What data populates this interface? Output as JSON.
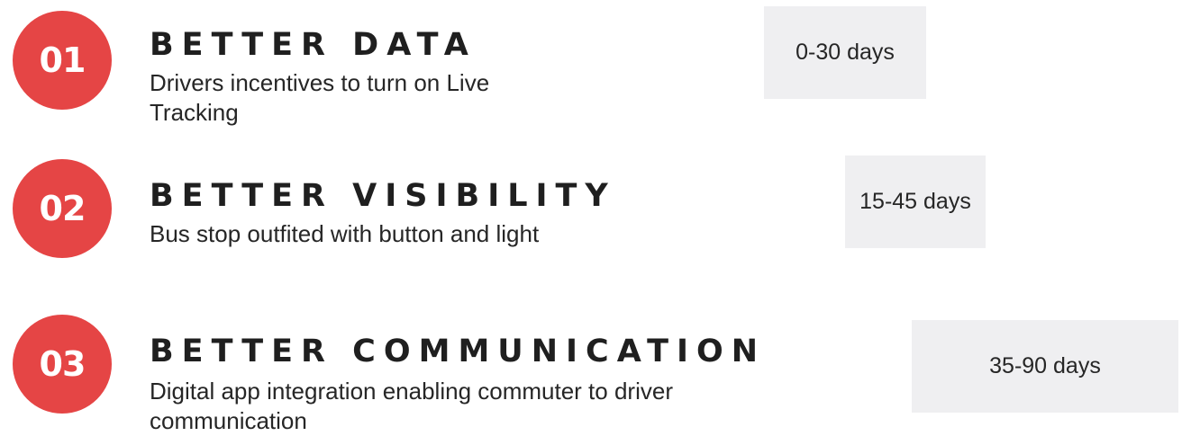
{
  "steps": [
    {
      "number": "01",
      "title": "BETTER DATA",
      "description": "Drivers incentives to turn on Live Tracking",
      "duration": "0-30 days"
    },
    {
      "number": "02",
      "title": "BETTER VISIBILITY",
      "description": "Bus stop outfited with button and light",
      "duration": "15-45 days"
    },
    {
      "number": "03",
      "title": "BETTER COMMUNICATION",
      "description": "Digital app integration enabling commuter to driver communication",
      "duration": "35-90 days"
    }
  ],
  "colors": {
    "accent": "#e54545",
    "badge_background": "#efeff1",
    "text": "#1f1f1f"
  }
}
